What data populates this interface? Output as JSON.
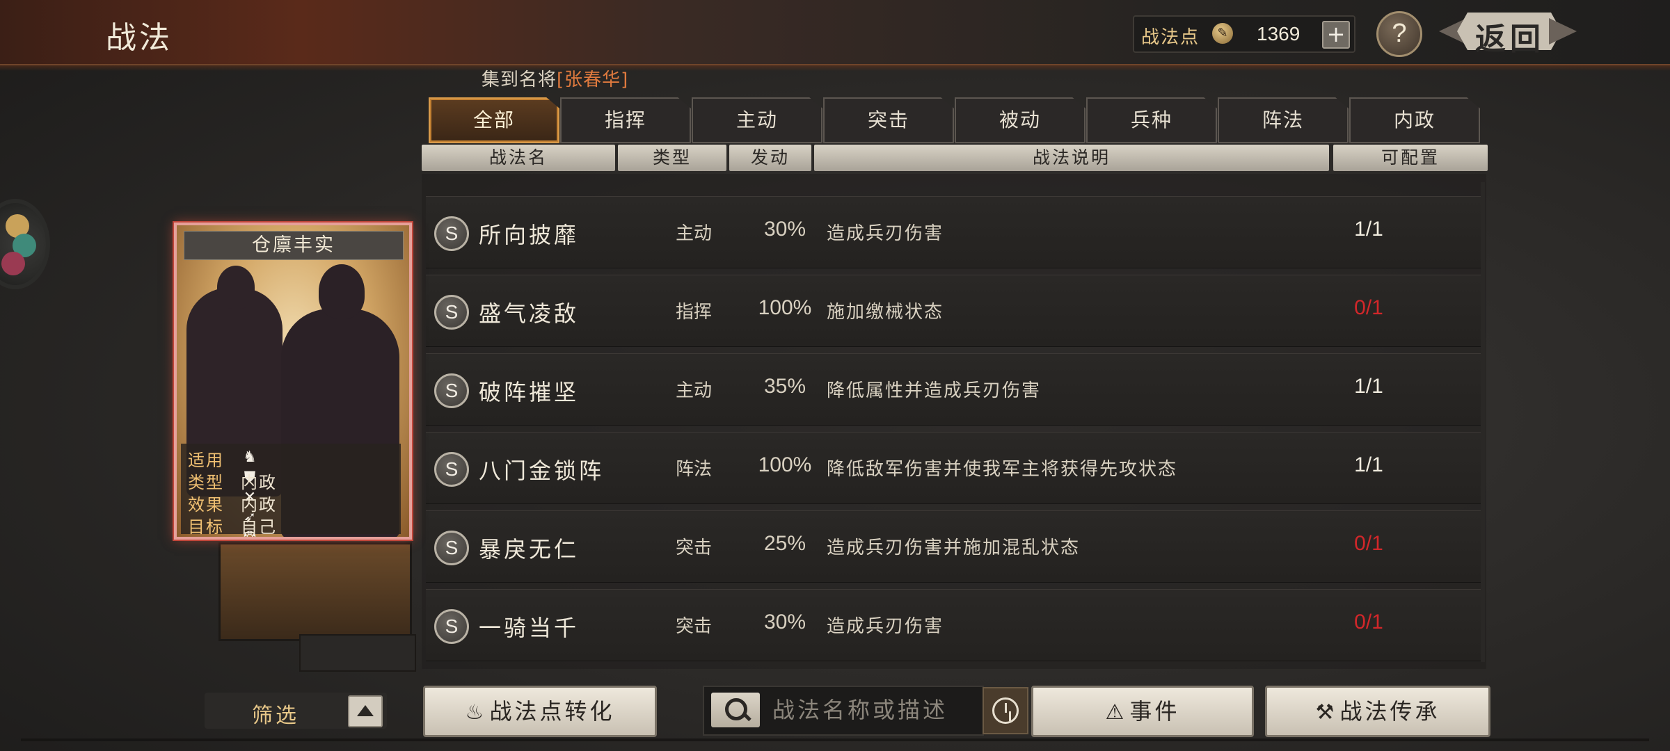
{
  "header": {
    "title": "战法"
  },
  "points": {
    "label": "战法点",
    "value": "1369",
    "plus": "+"
  },
  "help": "?",
  "back": "返回",
  "collect": {
    "prefix": "集到名将",
    "name": "[张春华]"
  },
  "tabs": [
    "全部",
    "指挥",
    "主动",
    "突击",
    "被动",
    "兵种",
    "阵法",
    "内政"
  ],
  "columns": [
    "战法名",
    "类型",
    "发动",
    "战法说明",
    "可配置"
  ],
  "rows": [
    {
      "badge": "S",
      "name": "所向披靡",
      "type": "主动",
      "rate": "30%",
      "desc": "造成兵刃伤害",
      "config": "1/1",
      "available": true
    },
    {
      "badge": "S",
      "name": "盛气凌敌",
      "type": "指挥",
      "rate": "100%",
      "desc": "施加缴械状态",
      "config": "0/1",
      "available": false
    },
    {
      "badge": "S",
      "name": "破阵摧坚",
      "type": "主动",
      "rate": "35%",
      "desc": "降低属性并造成兵刃伤害",
      "config": "1/1",
      "available": true
    },
    {
      "badge": "S",
      "name": "八门金锁阵",
      "type": "阵法",
      "rate": "100%",
      "desc": "降低敌军伤害并使我军主将获得先攻状态",
      "config": "1/1",
      "available": true
    },
    {
      "badge": "S",
      "name": "暴戾无仁",
      "type": "突击",
      "rate": "25%",
      "desc": "造成兵刃伤害并施加混乱状态",
      "config": "0/1",
      "available": false
    },
    {
      "badge": "S",
      "name": "一骑当千",
      "type": "突击",
      "rate": "30%",
      "desc": "造成兵刃伤害",
      "config": "0/1",
      "available": false
    }
  ],
  "card": {
    "title": "仓廪丰实",
    "fields": {
      "apply_label": "适用",
      "apply_icons": [
        "horse-icon",
        "shield-icon",
        "bow-icon",
        "spear-icon",
        "wheel-icon"
      ],
      "type_label": "类型",
      "type_value": "内政",
      "effect_label": "效果",
      "effect_value": "内政",
      "target_label": "目标",
      "target_value": "自己"
    }
  },
  "bottom": {
    "filter_label": "筛选",
    "convert_label": "战法点转化",
    "search_placeholder": "战法名称或描述",
    "event_label": "事件",
    "inherit_label": "战法传承"
  },
  "colors": {
    "accent": "#d89a4a",
    "unavailable": "#d2272a",
    "card_border": "#e6a09a"
  }
}
